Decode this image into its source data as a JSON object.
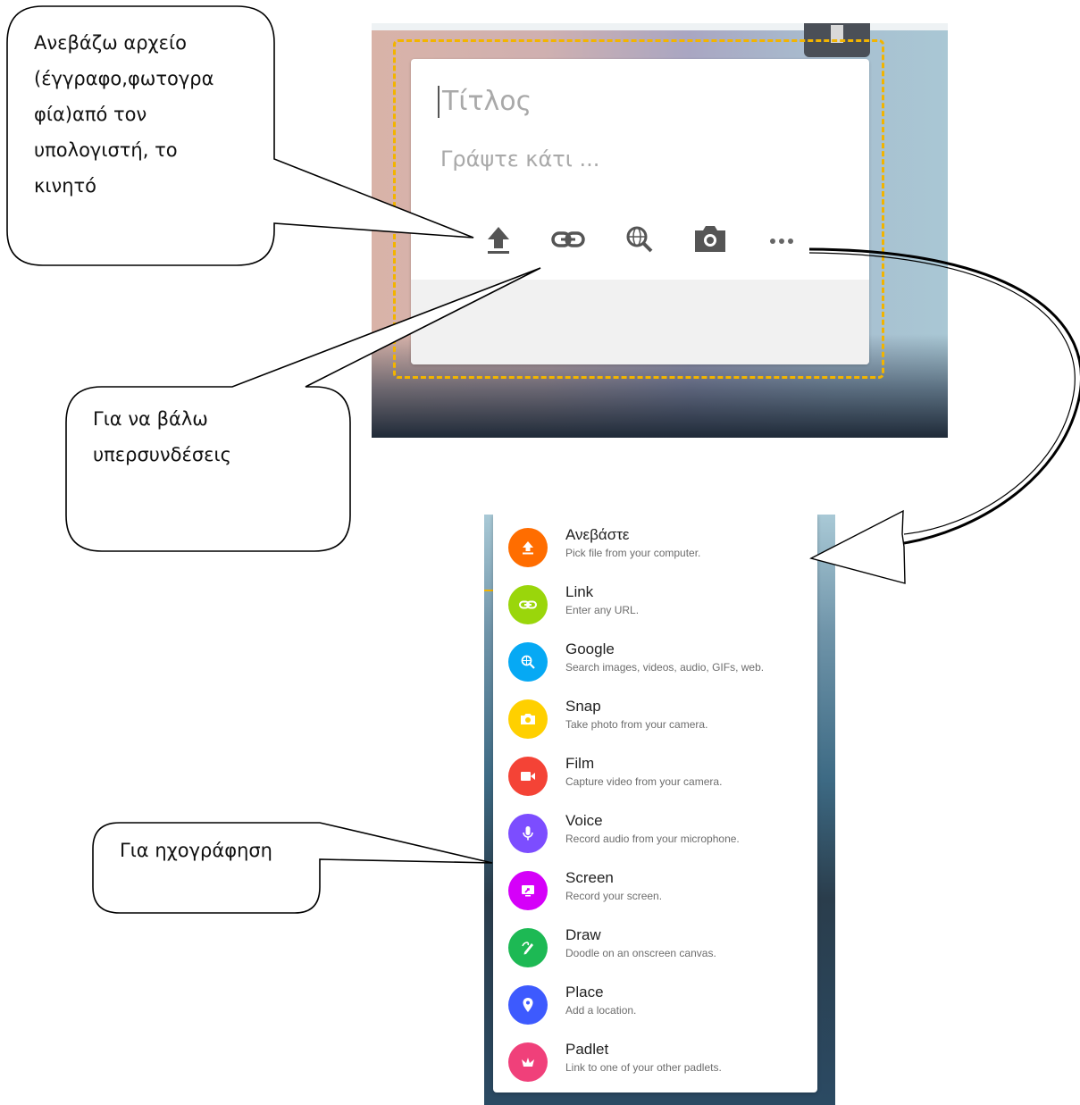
{
  "editor": {
    "title_placeholder": "Τίτλος",
    "body_placeholder": "Γράψτε κάτι ...",
    "tools": [
      {
        "icon": "upload-icon"
      },
      {
        "icon": "link-icon"
      },
      {
        "icon": "web-search-icon"
      },
      {
        "icon": "camera-icon"
      },
      {
        "icon": "more-icon"
      }
    ]
  },
  "attach_menu": {
    "items": [
      {
        "title": "Ανεβάστε",
        "desc": "Pick file from your computer.",
        "icon": "upload-icon",
        "color": "#ff6d00"
      },
      {
        "title": "Link",
        "desc": "Enter any URL.",
        "icon": "link-icon",
        "color": "#9ad60b"
      },
      {
        "title": "Google",
        "desc": "Search images, videos, audio, GIFs, web.",
        "icon": "web-search-icon",
        "color": "#06a9f4"
      },
      {
        "title": "Snap",
        "desc": "Take photo from your camera.",
        "icon": "camera-icon",
        "color": "#ffd000"
      },
      {
        "title": "Film",
        "desc": "Capture video from your camera.",
        "icon": "video-icon",
        "color": "#f44336"
      },
      {
        "title": "Voice",
        "desc": "Record audio from your microphone.",
        "icon": "microphone-icon",
        "color": "#7c4dff"
      },
      {
        "title": "Screen",
        "desc": "Record your screen.",
        "icon": "screen-record-icon",
        "color": "#d500f9"
      },
      {
        "title": "Draw",
        "desc": "Doodle on an onscreen canvas.",
        "icon": "draw-icon",
        "color": "#1db954"
      },
      {
        "title": "Place",
        "desc": "Add a location.",
        "icon": "location-pin-icon",
        "color": "#3d5afe"
      },
      {
        "title": "Padlet",
        "desc": "Link to one of your other padlets.",
        "icon": "padlet-icon",
        "color": "#f0407a"
      }
    ]
  },
  "callouts": {
    "upload_lines": [
      "Ανεβάζω αρχείο",
      "(έγγραφο,φωτογρα",
      "φία)από τον",
      "υπολογιστή, το",
      "κινητό"
    ],
    "link_lines": [
      "Για να βάλω",
      "υπερσυνδέσεις"
    ],
    "voice_lines": [
      "Για ηχογράφηση"
    ]
  }
}
